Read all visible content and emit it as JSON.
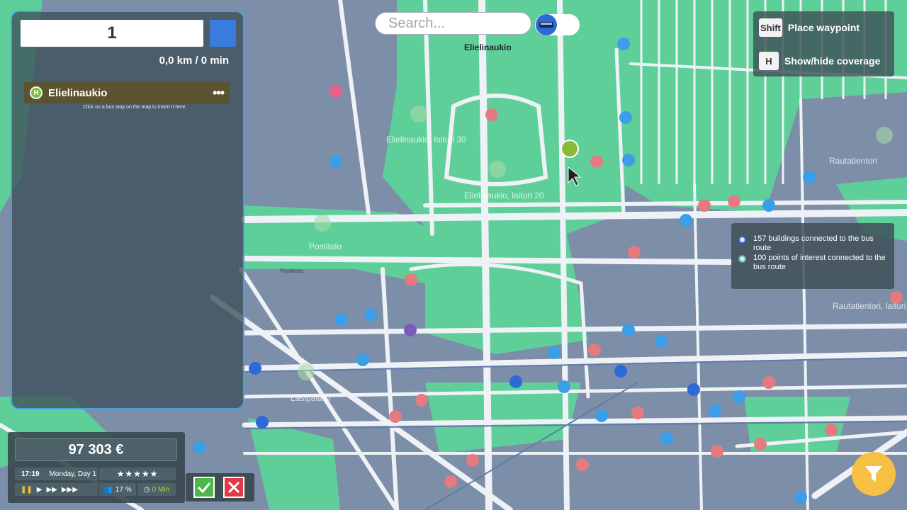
{
  "route_panel": {
    "route_number": "1",
    "distance_time": "0,0 km / 0 min",
    "stops": [
      {
        "icon": "H",
        "name": "Elielinaukio",
        "menu": "•••"
      }
    ],
    "hint": "Click on a bus stop on the map to insert it here."
  },
  "search": {
    "placeholder": "Search..."
  },
  "key_hints": [
    {
      "key": "Shift",
      "label": "Place waypoint"
    },
    {
      "key": "H",
      "label": "Show/hide coverage"
    }
  ],
  "coverage": {
    "buildings": "157 buildings connected to the bus route",
    "poi": "100 points of interest connected to the bus route"
  },
  "hud": {
    "money": "97 303 €",
    "time": "17:19",
    "day": "Monday, Day 1",
    "stars": "★★★★★",
    "popularity": "17 %",
    "wait": "0 Min"
  },
  "map_labels": {
    "elielinaukio": "Elielinaukio",
    "laituri30": "Elielinaukio, laituri 30",
    "laituri20": "Elielinaukio, laituri 20",
    "postitalo": "Postitalo",
    "lasipalatsi": "Lasipalatsi",
    "rautatientori": "Rautatientori",
    "rautatientori_laituri": "Rautatientori, laituri",
    "postikatu": "Postikatu"
  },
  "colors": {
    "road": "#eef2f6",
    "green": "#5fcf9a",
    "block": "#7d8ea8",
    "accent": "#3a7be0",
    "stop": "#8ab83a"
  }
}
